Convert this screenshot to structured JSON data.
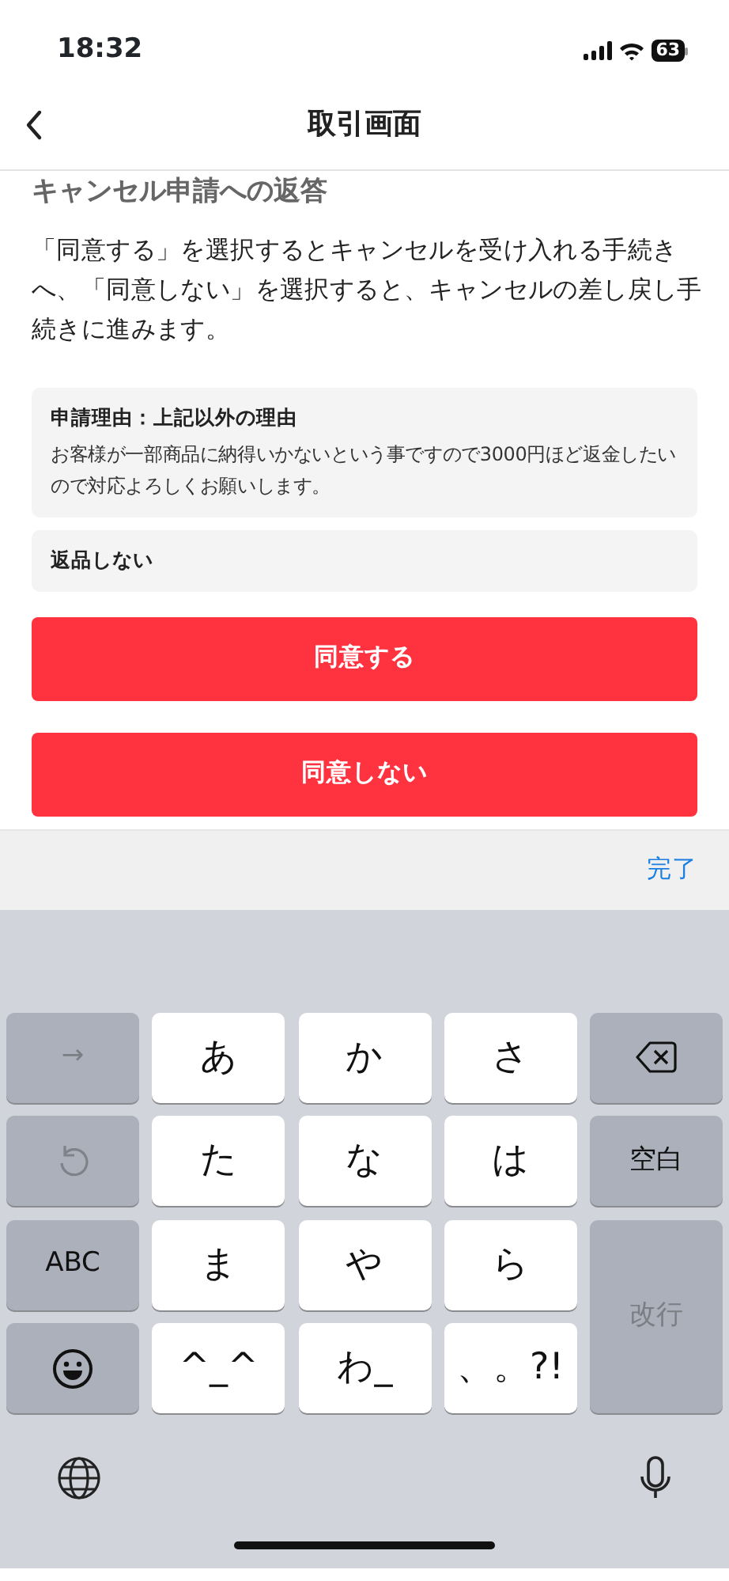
{
  "status_bar": {
    "time": "18:32",
    "battery": "63"
  },
  "nav": {
    "title": "取引画面"
  },
  "section_title": "キャンセル申請への返答",
  "description": "「同意する」を選択するとキャンセルを受け入れる手続きへ、「同意しない」を選択すると、キャンセルの差し戻し手続きに進みます。",
  "reason": {
    "label": "申請理由：上記以外の理由",
    "text": "お客様が一部商品に納得いかないという事ですので3000円ほど返金したいので対応よろしくお願いします。"
  },
  "return_option": "返品しない",
  "buttons": [
    "同意する",
    "同意しない"
  ],
  "toolbar": {
    "done": "完了"
  },
  "keyboard": {
    "keys": [
      {
        "kind": "function",
        "label": "→",
        "disabled": true
      },
      {
        "kind": "char",
        "label": "あ",
        "disabled": false
      },
      {
        "kind": "char",
        "label": "か",
        "disabled": false
      },
      {
        "kind": "char",
        "label": "さ",
        "disabled": false
      },
      {
        "kind": "delete",
        "disabled": false
      },
      {
        "kind": "undo",
        "disabled": true
      },
      {
        "kind": "char",
        "label": "た",
        "disabled": false
      },
      {
        "kind": "char",
        "label": "な",
        "disabled": false
      },
      {
        "kind": "char",
        "label": "は",
        "disabled": false
      },
      {
        "kind": "function",
        "label": "空白",
        "disabled": false
      },
      {
        "kind": "function",
        "label": "ABC",
        "disabled": false
      },
      {
        "kind": "char",
        "label": "ま",
        "disabled": false
      },
      {
        "kind": "char",
        "label": "や",
        "disabled": false
      },
      {
        "kind": "char",
        "label": "ら",
        "disabled": false
      },
      {
        "kind": "return",
        "label": "改行",
        "disabled": true
      },
      {
        "kind": "emoji",
        "disabled": false
      },
      {
        "kind": "char",
        "label": "^_^",
        "disabled": false
      },
      {
        "kind": "char",
        "label": "わ_",
        "disabled": false
      },
      {
        "kind": "char",
        "label": "、。?!",
        "disabled": false
      }
    ]
  }
}
